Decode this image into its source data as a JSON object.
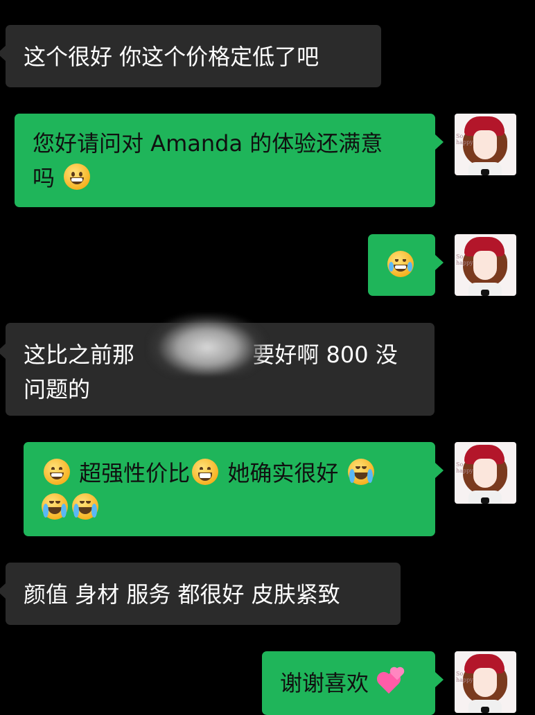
{
  "chat": {
    "messages": [
      {
        "side": "in",
        "text": "这个很好 你这个价格定低了吧"
      },
      {
        "side": "out",
        "text1": "您好请问对 Amanda 的体验还满意",
        "text2": "吗",
        "emoji": "grinning-face"
      },
      {
        "side": "out",
        "emoji": "tears-of-joy-face"
      },
      {
        "side": "in",
        "text1a": "这比之前那",
        "text1b": "要好啊 800 没",
        "text2": "问题的",
        "redaction": "scribbled-out-text"
      },
      {
        "side": "out",
        "emoji1": "grinning-face-with-smiling-eyes",
        "text1a": "超强性价比",
        "emoji2": "beaming-face",
        "text1b": "她确实很好",
        "emoji3": "loudly-crying-face",
        "emoji4": "loudly-crying-face",
        "emoji5": "loudly-crying-face"
      },
      {
        "side": "in",
        "text": "颜值 身材 服务 都很好 皮肤紧致"
      },
      {
        "side": "out",
        "text": "谢谢喜欢",
        "emoji": "revolving-hearts"
      }
    ],
    "avatar": {
      "name": "user-avatar",
      "icon": "girl-with-red-hat-avatar",
      "tag": "So happy"
    }
  },
  "colors": {
    "background": "#000000",
    "incoming": "#2b2b2b",
    "outgoing": "#1fb55a"
  }
}
